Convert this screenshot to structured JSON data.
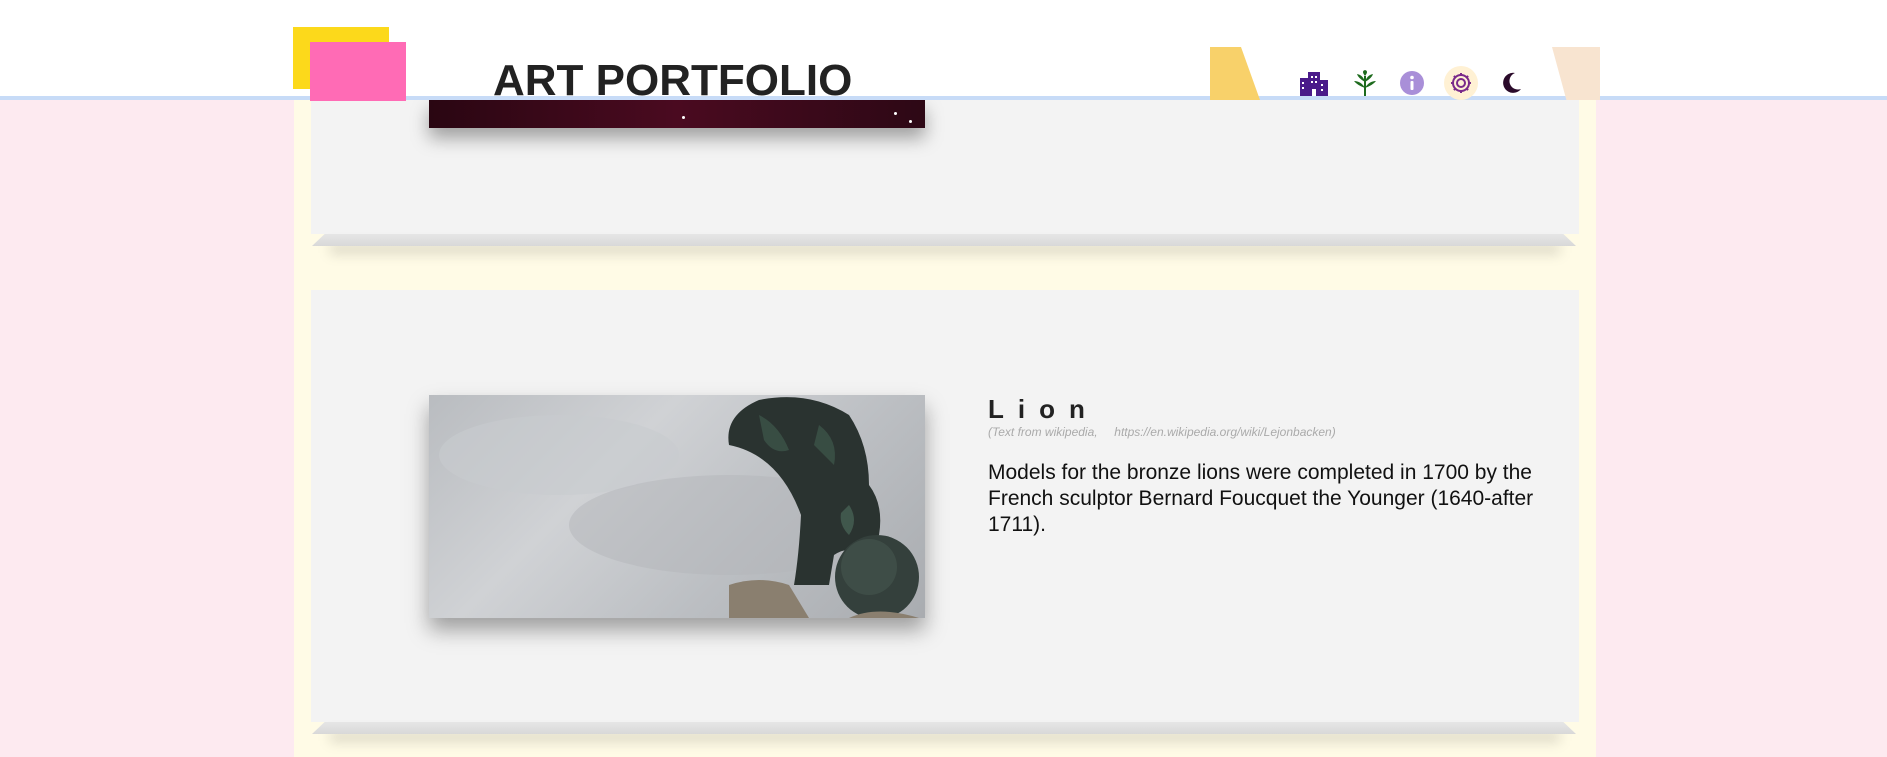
{
  "header": {
    "site_title": "ART PORTFOLIO",
    "nav": [
      {
        "icon": "buildings-icon",
        "color": "#4a1a8a"
      },
      {
        "icon": "leaf-icon",
        "color": "#1e6b1e"
      },
      {
        "icon": "info-icon",
        "color": "#a98fd8"
      },
      {
        "icon": "gear-icon",
        "color": "#7a2a8a",
        "active": true
      },
      {
        "icon": "moon-icon",
        "color": "#2a0a2a"
      }
    ]
  },
  "items": [
    {
      "title": "Lion",
      "credit_source": "(Text from wikipedia,",
      "credit_url": "https://en.wikipedia.org/wiki/Lejonbacken)",
      "description": "Models for the bronze lions were completed in 1700 by the French sculptor Bernard Foucquet the Younger (1640-after 1711)."
    }
  ],
  "colors": {
    "page_background": "#fdeaf0",
    "column_background": "#fffbe6",
    "card_background": "#f3f3f3",
    "header_border": "#c7dbf7",
    "accent_yellow": "#fcd91b",
    "accent_pink": "#ff6bb5"
  }
}
